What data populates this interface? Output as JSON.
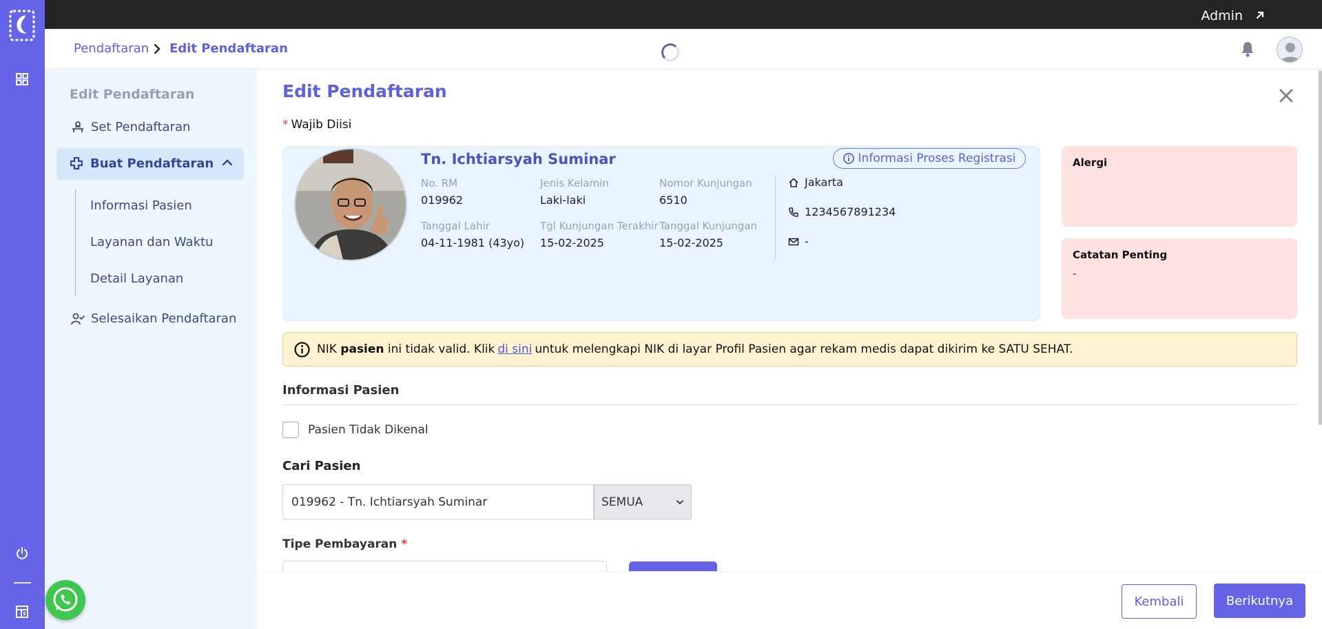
{
  "topbar": {
    "user_label": "Admin"
  },
  "header": {
    "breadcrumb_root": "Pendaftaran",
    "breadcrumb_current": "Edit Pendaftaran"
  },
  "sidenav": {
    "title": "Edit Pendaftaran",
    "set_label": "Set Pendaftaran",
    "buat_label": "Buat Pendaftaran",
    "sub_items": [
      "Informasi Pasien",
      "Layanan dan Waktu",
      "Detail Layanan"
    ],
    "selesai_label": "Selesaikan Pendaftaran"
  },
  "main": {
    "title": "Edit Pendaftaran",
    "required_note": "Wajib Diisi",
    "patient": {
      "name": "Tn. Ichtiarsyah Suminar",
      "info_button": "Informasi Proses Registrasi",
      "no_rm_label": "No. RM",
      "no_rm": "019962",
      "gender_label": "Jenis Kelamin",
      "gender": "Laki-laki",
      "visit_no_label": "Nomor Kunjungan",
      "visit_no": "6510",
      "dob_label": "Tanggal Lahir",
      "dob": "04-11-1981 (43yo)",
      "last_visit_label": "Tgl Kunjungan Terakhir",
      "last_visit": "15-02-2025",
      "visit_date_label": "Tanggal Kunjungan",
      "visit_date": "15-02-2025",
      "city": "Jakarta",
      "phone": "1234567891234",
      "email": "-"
    },
    "alergi": {
      "title": "Alergi",
      "value": ""
    },
    "catatan": {
      "title": "Catatan Penting",
      "value": "-"
    },
    "warning": {
      "prefix": "NIK",
      "bold": "pasien",
      "mid": "ini tidak valid. Klik",
      "link": "di sini",
      "suffix": "untuk melengkapi NIK di layar Profil Pasien agar rekam medis dapat dikirim ke SATU SEHAT."
    },
    "section_title": "Informasi Pasien",
    "unknown_patient_label": "Pasien Tidak Dikenal",
    "cari_label": "Cari Pasien",
    "cari_value": "019962 - Tn. Ichtiarsyah Suminar",
    "cari_filter": "SEMUA",
    "tipe_label": "Tipe Pembayaran"
  },
  "footer": {
    "back_label": "Kembali",
    "next_label": "Berikutnya"
  },
  "colors": {
    "accent": "#6563e8",
    "rail": "#6563e8",
    "warning_bg": "#fff3d2",
    "alert_card_bg": "#ffe1e1",
    "patient_card_bg": "#eaf4fe"
  }
}
